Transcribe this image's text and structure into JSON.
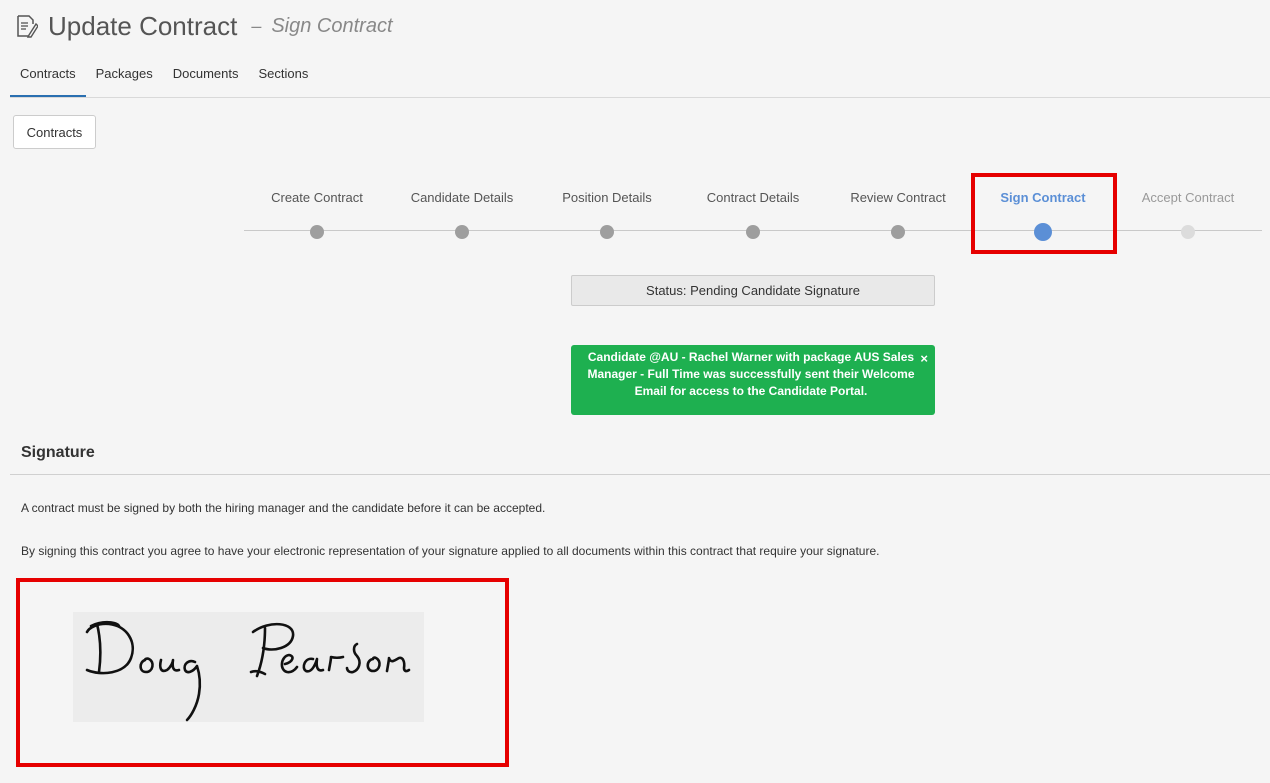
{
  "header": {
    "title": "Update Contract",
    "separator": "–",
    "subtitle": "Sign Contract"
  },
  "tabs": [
    {
      "label": "Contracts",
      "active": true
    },
    {
      "label": "Packages",
      "active": false
    },
    {
      "label": "Documents",
      "active": false
    },
    {
      "label": "Sections",
      "active": false
    }
  ],
  "contracts_button": "Contracts",
  "steps": [
    {
      "label": "Create Contract",
      "state": "done"
    },
    {
      "label": "Candidate Details",
      "state": "done"
    },
    {
      "label": "Position Details",
      "state": "done"
    },
    {
      "label": "Contract Details",
      "state": "done"
    },
    {
      "label": "Review Contract",
      "state": "done"
    },
    {
      "label": "Sign Contract",
      "state": "active"
    },
    {
      "label": "Accept Contract",
      "state": "future"
    }
  ],
  "status": "Status: Pending Candidate Signature",
  "alert": {
    "message": "Candidate @AU - Rachel Warner with package AUS Sales Manager - Full Time was successfully sent their Welcome Email for access to the Candidate Portal.",
    "close": "×"
  },
  "signature": {
    "heading": "Signature",
    "paragraph1": "A contract must be signed by both the hiring manager and the candidate before it can be accepted.",
    "paragraph2": "By signing this contract you agree to have your electronic representation of your signature applied to all documents within this contract that require your signature.",
    "signed_name": "Doug Pearson"
  },
  "colors": {
    "accent": "#5b8fd6",
    "alert_green": "#1eb050",
    "highlight_red": "#e60000",
    "tab_underline": "#2a6fb0"
  }
}
